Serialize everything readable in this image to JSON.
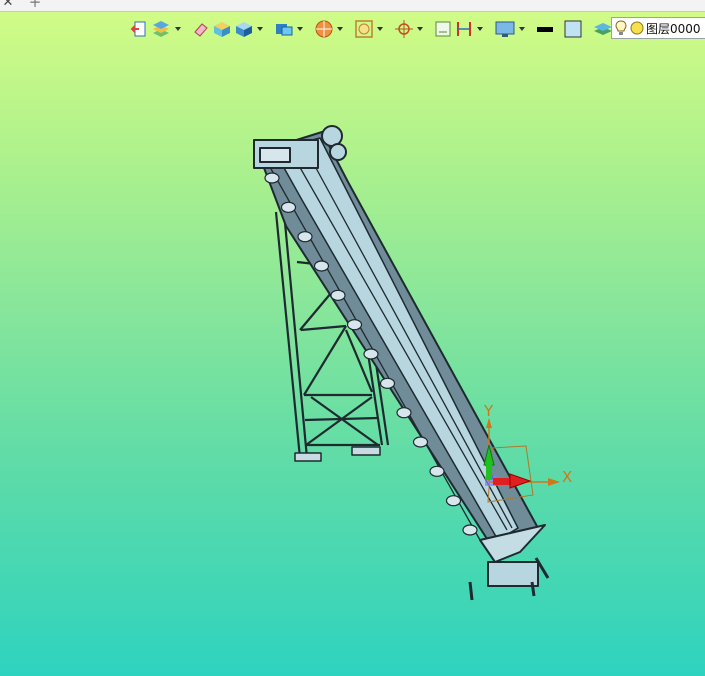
{
  "tabs": {
    "close_glyph": "✕",
    "add_glyph": "+"
  },
  "toolbar": {
    "icons": [
      "exit-view-icon",
      "display-style-icon",
      "eraser-icon",
      "solid-box-icon",
      "view-cube-icon",
      "component-icon",
      "sphere-section-icon",
      "zoom-fit-icon",
      "target-icon",
      "frame-icon",
      "dimension-icon",
      "monitor-icon",
      "color-black-swatch",
      "fill-light-blue-swatch",
      "layer-stack-icon"
    ],
    "black_color": "#000000",
    "fill_color": "#bfe3f0"
  },
  "layer": {
    "name": "图层0000"
  },
  "triad": {
    "x_label": "X",
    "y_label": "Y"
  },
  "colors": {
    "bg_top": "#d4fc86",
    "bg_bottom": "#2ed3bf",
    "model_fill": "#b8d6e0",
    "axis_x": "#e02020",
    "axis_y": "#20c020"
  }
}
